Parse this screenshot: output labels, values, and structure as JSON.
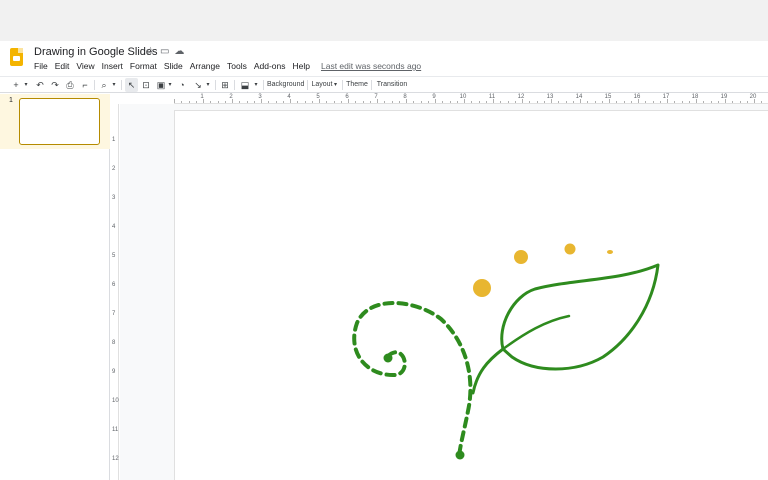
{
  "doc": {
    "title": "Drawing in Google Slides"
  },
  "menu": {
    "items": [
      "File",
      "Edit",
      "View",
      "Insert",
      "Format",
      "Slide",
      "Arrange",
      "Tools",
      "Add-ons",
      "Help"
    ],
    "last_edit": "Last edit was seconds ago"
  },
  "toolbar": {
    "background": "Background",
    "layout": "Layout",
    "theme": "Theme",
    "transition": "Transition"
  },
  "ruler": {
    "h_labels": [
      "1",
      "2",
      "3",
      "4",
      "5",
      "6",
      "7",
      "8",
      "9",
      "10",
      "11",
      "12",
      "13",
      "14",
      "15",
      "16",
      "17",
      "18",
      "19",
      "20"
    ],
    "v_labels": [
      "1",
      "2",
      "3",
      "4",
      "5",
      "6",
      "7",
      "8",
      "9",
      "10",
      "11",
      "12"
    ]
  },
  "filmstrip": {
    "slides": [
      {
        "number": "1"
      }
    ]
  },
  "colors": {
    "stroke_green": "#2e8b1e",
    "dot_yellow": "#e8b630",
    "logo_yellow": "#f4b400"
  },
  "icons": [
    "slides-logo",
    "star-icon",
    "folder-icon",
    "cloud-icon",
    "new-slide-icon",
    "undo-icon",
    "redo-icon",
    "print-icon",
    "paint-format-icon",
    "zoom-icon",
    "select-icon",
    "textbox-icon",
    "image-icon",
    "shape-icon",
    "line-icon",
    "comment-icon",
    "fill-color-icon"
  ]
}
